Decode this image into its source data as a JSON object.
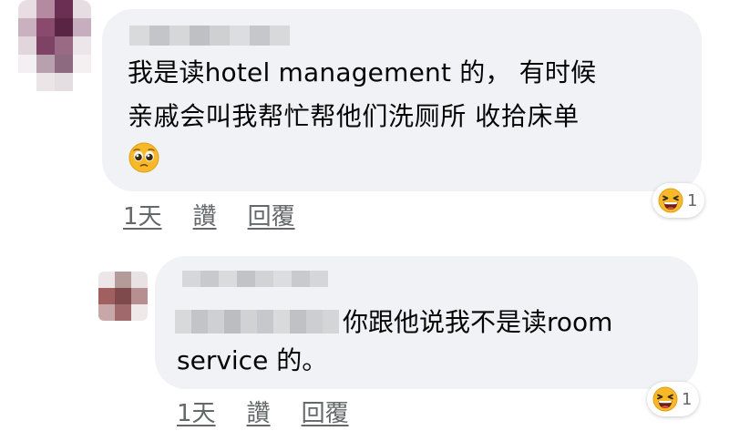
{
  "comments": [
    {
      "text_lines": [
        "我是读hotel management 的，  有时候",
        "亲戚会叫我帮忙帮他们洗厕所 收拾床单"
      ],
      "emoji": "pleading-face",
      "actions": {
        "time": "1天",
        "like": "讚",
        "reply": "回覆"
      },
      "reaction": {
        "type": "laughing-face",
        "count": "1"
      }
    },
    {
      "text_lines": [
        "你跟他说我不是读room",
        "service 的。"
      ],
      "actions": {
        "time": "1天",
        "like": "讚",
        "reply": "回覆"
      },
      "reaction": {
        "type": "laughing-face",
        "count": "1"
      }
    }
  ],
  "colors": {
    "bubble": "#f0f2f5",
    "text": "#050505",
    "meta": "#65676b",
    "emoji_yellow": "#f7b928"
  }
}
